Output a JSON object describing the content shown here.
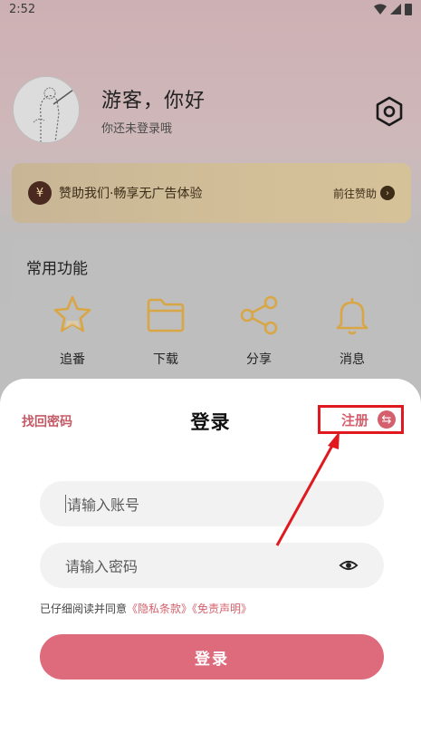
{
  "status_bar": {
    "time": "2:52"
  },
  "profile": {
    "greeting": "游客，你好",
    "subtitle": "你还未登录哦"
  },
  "sponsor": {
    "text": "赞助我们·畅享无广告体验",
    "action": "前往赞助",
    "icon_symbol": "¥"
  },
  "features": {
    "title": "常用功能",
    "items": [
      {
        "label": "追番",
        "icon": "star-icon"
      },
      {
        "label": "下载",
        "icon": "folder-icon"
      },
      {
        "label": "分享",
        "icon": "share-icon"
      },
      {
        "label": "消息",
        "icon": "bell-icon"
      }
    ]
  },
  "login_sheet": {
    "forgot_password": "找回密码",
    "title": "登录",
    "register": "注册",
    "account_placeholder": "请输入账号",
    "password_placeholder": "请输入密码",
    "agreement_prefix": "已仔细阅读并同意",
    "privacy_link": "《隐私条款》",
    "disclaimer_link": "《免责声明》",
    "submit": "登录"
  },
  "colors": {
    "accent": "#de6b7c",
    "link": "#d3606c",
    "highlight_box": "#e0191f",
    "feature_icon": "#d8a645"
  }
}
